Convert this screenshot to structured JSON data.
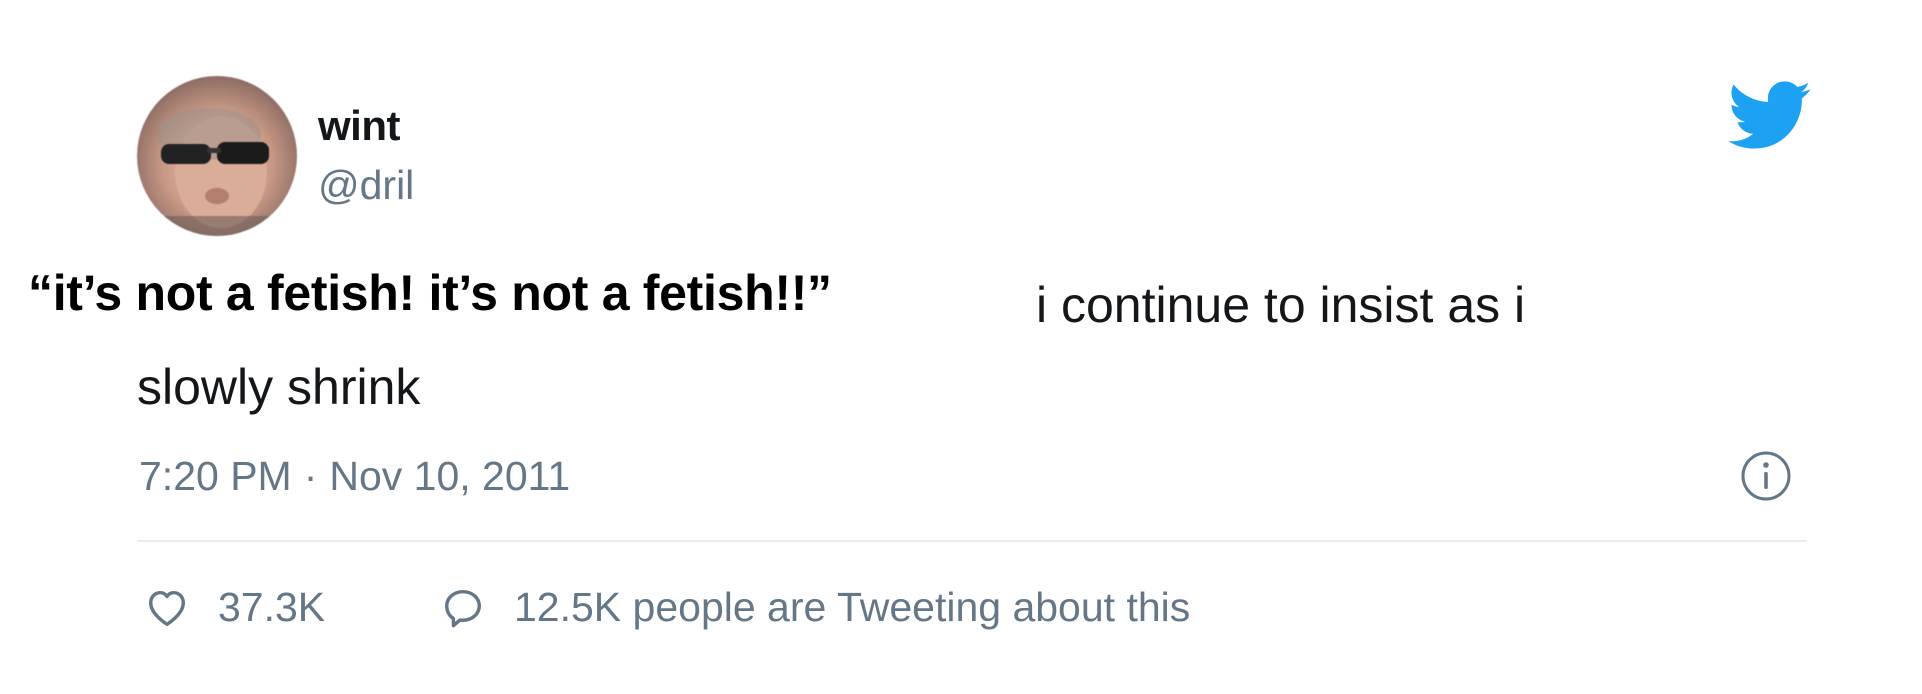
{
  "tweet": {
    "author": {
      "display_name": "wint",
      "handle": "@dril"
    },
    "quote_text": "“it’s not a fetish! it’s not a fetish!!”",
    "text_line1": "i continue to insist as i",
    "text_line2": "slowly shrink",
    "time": "7:20 PM",
    "separator": "·",
    "date": "Nov 10, 2011",
    "likes": "37.3K",
    "talking": "12.5K people are Tweeting about this"
  },
  "icons": {
    "brand": "twitter-bird-icon",
    "info": "info-icon",
    "like": "heart-icon",
    "reply": "speech-bubble-icon"
  },
  "colors": {
    "brand_blue": "#1da1f2",
    "secondary_text": "#657786",
    "primary_text": "#14171a",
    "divider": "#e6ecf0"
  }
}
